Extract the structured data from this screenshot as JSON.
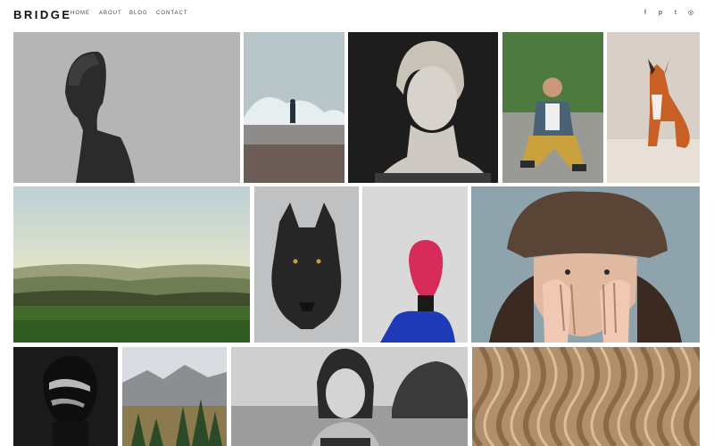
{
  "header": {
    "logo": "BRIDGE",
    "nav": [
      "HOME",
      "ABOUT",
      "BLOG",
      "CONTACT"
    ],
    "social": [
      {
        "icon": "facebook-icon",
        "glyph": "f"
      },
      {
        "icon": "pinterest-icon",
        "glyph": "p"
      },
      {
        "icon": "twitter-icon",
        "glyph": "t"
      },
      {
        "icon": "instagram-icon",
        "glyph": "◎"
      }
    ]
  },
  "gallery": {
    "items": [
      {
        "subject": "bald man in profile"
      },
      {
        "subject": "person facing crashing wave"
      },
      {
        "subject": "blonde woman portrait"
      },
      {
        "subject": "man in denim jacket drinking"
      },
      {
        "subject": "red fox"
      },
      {
        "subject": "green hills landscape"
      },
      {
        "subject": "black wolf"
      },
      {
        "subject": "person with pink head wrap"
      },
      {
        "subject": "woman in fur hat covering face"
      },
      {
        "subject": "face painted portrait"
      },
      {
        "subject": "mountain pine forest"
      },
      {
        "subject": "wet hair woman black and white"
      },
      {
        "subject": "wavy wood texture"
      }
    ]
  }
}
